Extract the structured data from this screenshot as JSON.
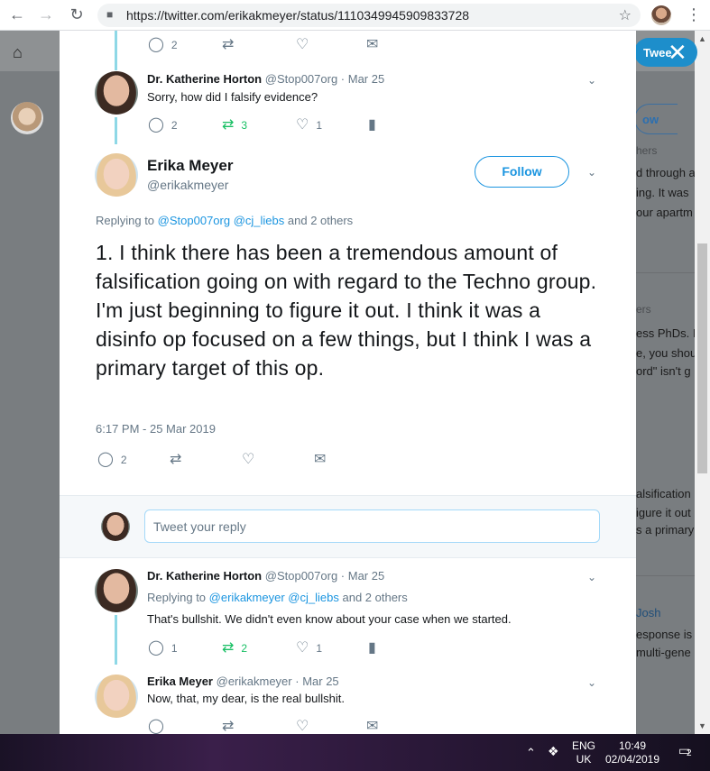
{
  "browser": {
    "url": "https://twitter.com/erikakmeyer/status/1110349945909833728",
    "back_icon": "←",
    "forward_icon": "→",
    "reload_icon": "↻",
    "lock_icon": "🔒",
    "star_icon": "☆",
    "menu_icon": "⋮"
  },
  "background": {
    "tweet_button": "Twee",
    "follow_partial": "ow",
    "snippets": [
      "d through a",
      "ing. It was",
      "our apartm",
      "ers",
      "ess PhDs. I",
      "e, you shou",
      "ord\" isn't g",
      "alsification",
      "igure it out",
      "s a primary",
      "Josh",
      "esponse is",
      "multi-gene",
      "hers"
    ]
  },
  "modal": {
    "close_icon": "✕",
    "top_actions": {
      "reply_count": "2"
    },
    "tweet1": {
      "name": "Dr. Katherine Horton",
      "handle": "@Stop007org",
      "date": "· Mar 25",
      "text": "Sorry, how did I falsify evidence?",
      "replies": "2",
      "retweets": "3",
      "likes": "1"
    },
    "main": {
      "name": "Erika Meyer",
      "handle": "@erikakmeyer",
      "follow_label": "Follow",
      "replying_prefix": "Replying to",
      "replying_to_1": "@Stop007org",
      "replying_to_2": "@cj_liebs",
      "replying_suffix": "and 2 others",
      "text": "1. I think there has been a tremendous amount of falsification going on with regard to the Techno group. I'm just beginning to figure it out. I think it was a disinfo op focused on a few things, but I think I was a primary target of this op.",
      "timestamp": "6:17 PM - 25 Mar 2019",
      "replies": "2"
    },
    "reply_box": {
      "placeholder": "Tweet your reply"
    },
    "tweet2": {
      "name": "Dr. Katherine Horton",
      "handle": "@Stop007org",
      "date": "· Mar 25",
      "replying_prefix": "Replying to",
      "replying_to_1": "@erikakmeyer",
      "replying_to_2": "@cj_liebs",
      "replying_suffix": "and 2 others",
      "text": "That's bullshit. We didn't even know about your case when we started.",
      "replies": "1",
      "retweets": "2",
      "likes": "1"
    },
    "tweet3": {
      "name": "Erika Meyer",
      "handle": "@erikakmeyer",
      "date": "· Mar 25",
      "text": "Now, that, my dear, is the real bullshit."
    }
  },
  "taskbar": {
    "lang_top": "ENG",
    "lang_bottom": "UK",
    "time": "10:49",
    "date": "02/04/2019",
    "notification_count": "2"
  },
  "colors": {
    "retweet_green": "#17bf63",
    "link_blue": "#1b95e0",
    "thread_line": "#8ed8e6"
  }
}
